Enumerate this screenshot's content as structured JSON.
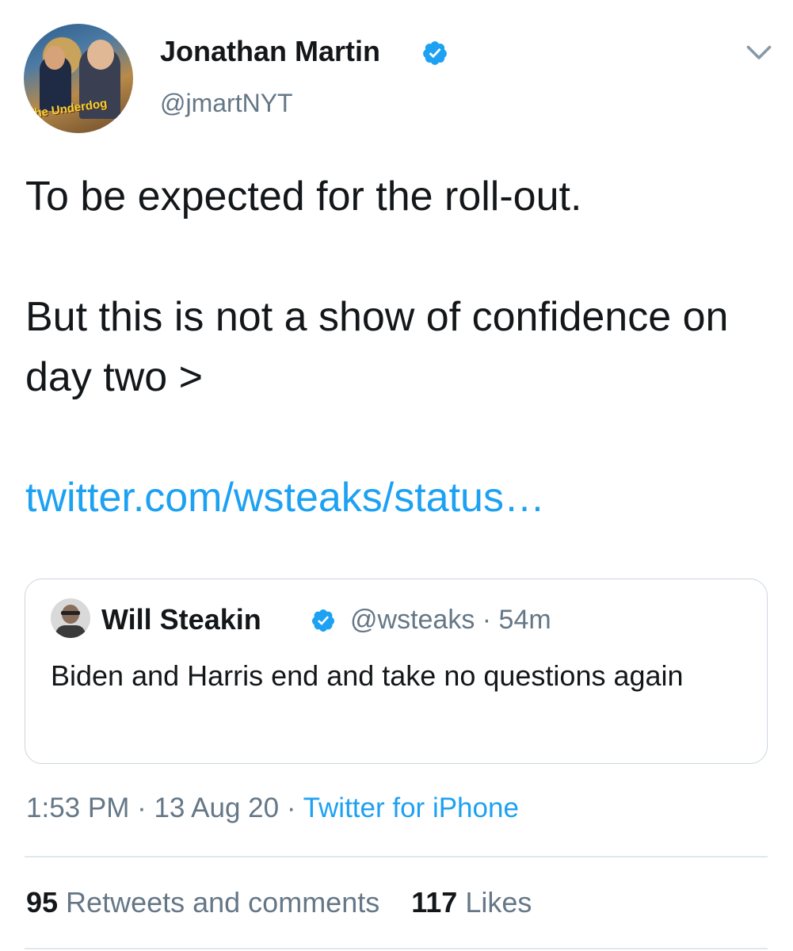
{
  "author": {
    "name": "Jonathan Martin",
    "handle": "@jmartNYT",
    "avatar_text": "The Underdog"
  },
  "tweet": {
    "line1": "To be expected for the roll-out.",
    "line2": "But this is not a show of confidence on day two >",
    "link": "twitter.com/wsteaks/status…"
  },
  "quoted": {
    "name": "Will Steakin",
    "handle_time": "@wsteaks · 54m",
    "text": "Biden and Harris end and take no questions again"
  },
  "meta": {
    "time_date": "1:53 PM · 13 Aug 20 · ",
    "app": "Twitter for iPhone"
  },
  "stats": {
    "retweets_count": "95",
    "retweets_label": " Retweets and comments",
    "likes_count": "117",
    "likes_label": " Likes"
  },
  "colors": {
    "accent": "#1da1f2",
    "secondary_text": "#657786",
    "primary_text": "#14171a"
  },
  "icons": {
    "verified": "verified-badge-icon",
    "chevron": "chevron-down-icon"
  }
}
